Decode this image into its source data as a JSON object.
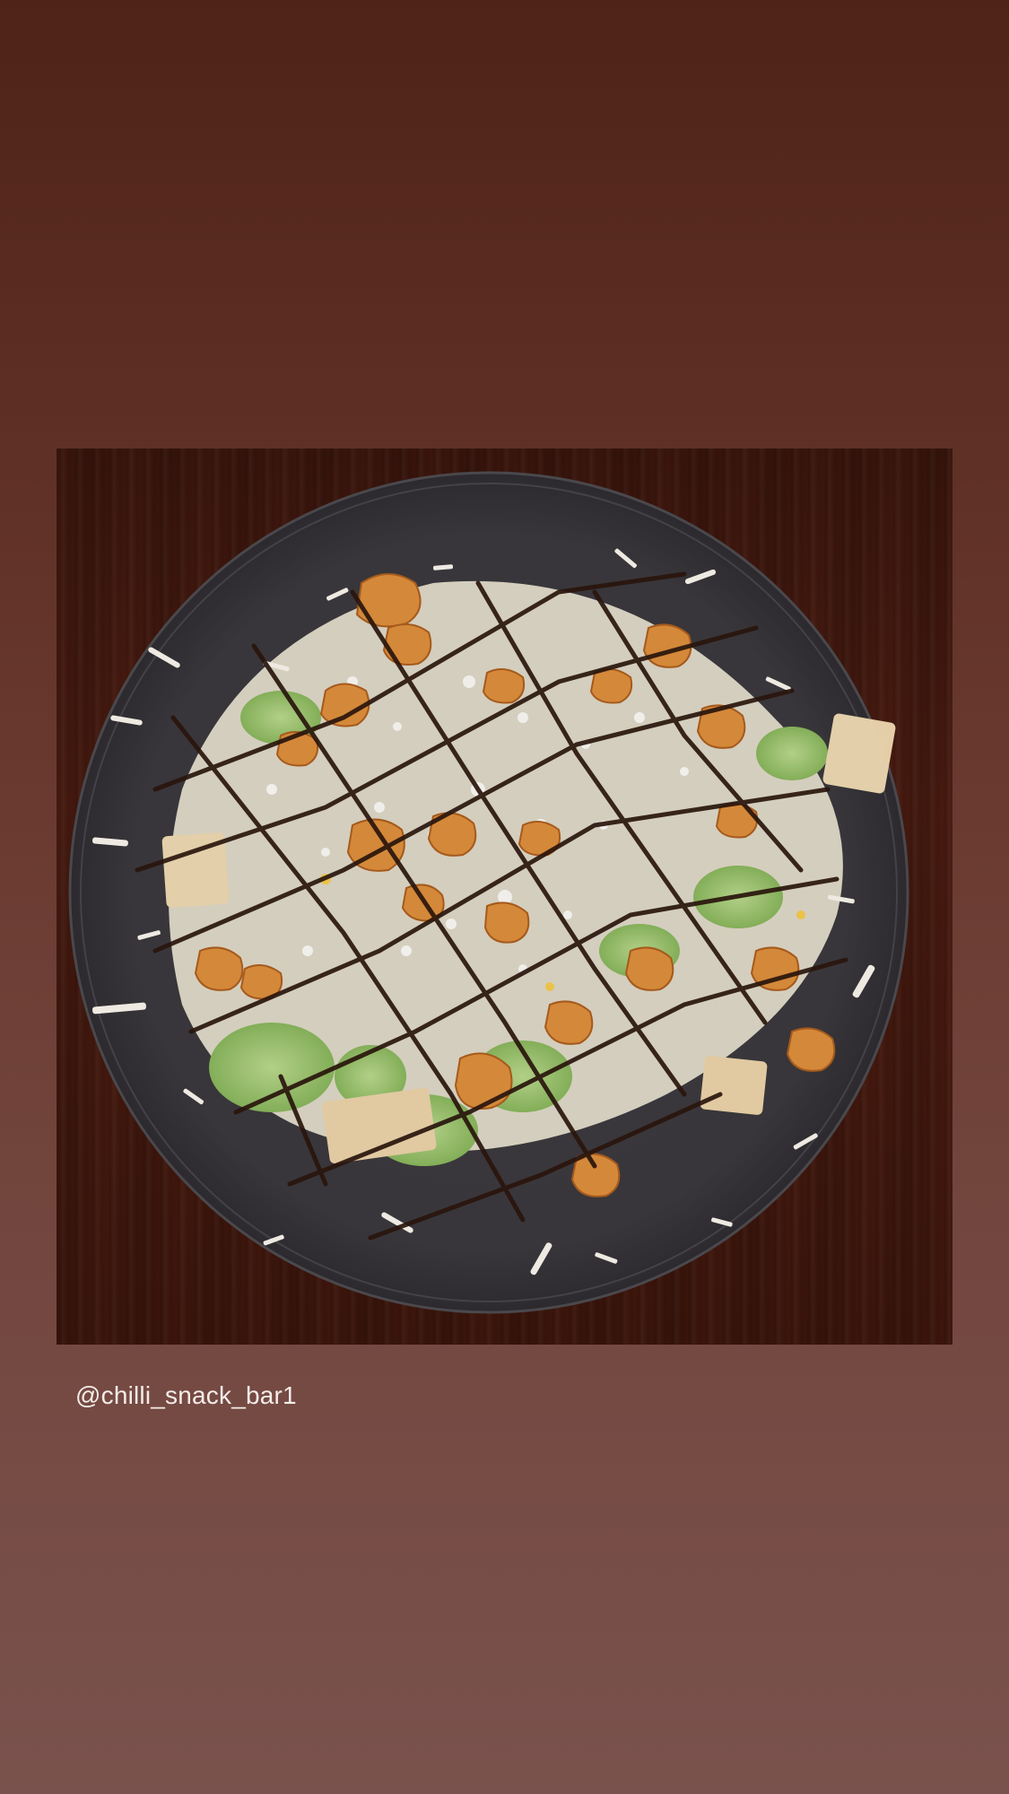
{
  "story": {
    "mention": "@chilli_snack_bar1"
  },
  "icons": {
    "photo": "food-photo-salad"
  },
  "colors": {
    "background_top": "#4f2317",
    "background_bottom": "#7a524d",
    "mention_text": "#f4ece9"
  }
}
